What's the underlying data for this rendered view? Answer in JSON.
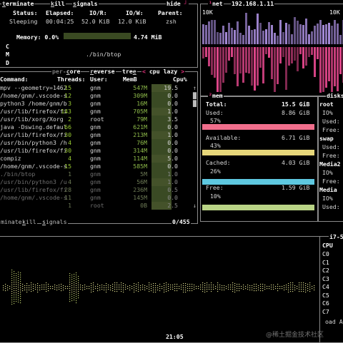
{
  "proc_detail": {
    "actions": {
      "terminate": "terminate",
      "kill": "kill",
      "signals": "signals",
      "hide": "hide"
    },
    "labels": {
      "status": "Status:",
      "elapsed": "Elapsed:",
      "io_r": "IO/R:",
      "io_w": "IO/W:",
      "parent": "Parent:"
    },
    "values": {
      "status": "Sleeping",
      "elapsed": "00:04:25",
      "io_r": "52.0 KiB",
      "io_w": "12.0 KiB",
      "parent": "zsh"
    },
    "memory_label": "Memory: 0.0%",
    "memory_value": "4.74 MiB",
    "memory_fraction": 0.0,
    "cmd_letters": [
      "C",
      "M",
      "D"
    ],
    "cmd_path": "./bin/btop"
  },
  "proc_table": {
    "tabs": {
      "per_core": "per-core",
      "reverse": "reverse",
      "tree": "tree",
      "cpu_lazy": "< cpu lazy >"
    },
    "headers": {
      "command": "Command:",
      "threads": "Threads:",
      "user": "User:",
      "mem": "MemB",
      "cpu": "Cpu%"
    },
    "rows": [
      {
        "command": "mpv --geometry=1462",
        "threads": "15",
        "user": "gnm",
        "mem": "547M",
        "cpu": "19.5"
      },
      {
        "command": "/home/gnm/.vscode-s",
        "threads": "12",
        "user": "gnm",
        "mem": "309M",
        "cpu": "0.0"
      },
      {
        "command": "python3 /home/gnm/b",
        "threads": "3",
        "user": "gnm",
        "mem": "16M",
        "cpu": "0.0"
      },
      {
        "command": "/usr/lib/firefox/fi",
        "threads": "143",
        "user": "gnm",
        "mem": "705M",
        "cpu": "1.0"
      },
      {
        "command": "/usr/lib/xorg/Xorg",
        "threads": "2",
        "user": "root",
        "mem": "79M",
        "cpu": "3.5"
      },
      {
        "command": "java -Dswing.defaul",
        "threads": "66",
        "user": "gnm",
        "mem": "621M",
        "cpu": "0.0"
      },
      {
        "command": "/usr/lib/firefox/fi",
        "threads": "30",
        "user": "gnm",
        "mem": "213M",
        "cpu": "1.0"
      },
      {
        "command": "/usr/bin/python3 /h",
        "threads": "4",
        "user": "gnm",
        "mem": "76M",
        "cpu": "0.0"
      },
      {
        "command": "/usr/lib/firefox/fi",
        "threads": "30",
        "user": "gnm",
        "mem": "314M",
        "cpu": "0.0"
      },
      {
        "command": "compiz",
        "threads": "4",
        "user": "gnm",
        "mem": "114M",
        "cpu": "5.0"
      },
      {
        "command": "/home/gnm/.vscode-s",
        "threads": "15",
        "user": "gnm",
        "mem": "585M",
        "cpu": "0.0"
      },
      {
        "command": "./bin/btop",
        "threads": "1",
        "user": "gnm",
        "mem": "5M",
        "cpu": "1.0"
      },
      {
        "command": "/usr/bin/python3 /u",
        "threads": "4",
        "user": "gnm",
        "mem": "56M",
        "cpu": "1.0"
      },
      {
        "command": "/usr/lib/firefox/fi",
        "threads": "28",
        "user": "gnm",
        "mem": "236M",
        "cpu": "0.5"
      },
      {
        "command": "/home/gnm/.vscode-s",
        "threads": "11",
        "user": "gnm",
        "mem": "145M",
        "cpu": "0.0"
      },
      {
        "command": "",
        "threads": "1",
        "user": "root",
        "mem": "0B",
        "cpu": "2.5"
      }
    ],
    "footer": {
      "terminate": "terminate",
      "kill": "kill",
      "signals": "signals",
      "count": "0/455"
    }
  },
  "net": {
    "title": "net",
    "address": "192.168.1.11",
    "scale_left": "10K",
    "scale_right": "10K",
    "download_color": "#a58ad8",
    "upload_color": "#e0468a"
  },
  "mem": {
    "title": "mem",
    "total_label": "Total:",
    "total_value": "15.5 GiB",
    "used_label": "Used:",
    "used_value": "8.86 GiB",
    "used_pct": "57%",
    "used_fraction": 0.57,
    "used_color": "#f06e8c",
    "avail_label": "Available:",
    "avail_value": "6.71 GiB",
    "avail_pct": "43%",
    "avail_fraction": 0.43,
    "avail_color": "#e6d67a",
    "cached_label": "Cached:",
    "cached_value": "4.03 GiB",
    "cached_pct": "26%",
    "cached_fraction": 0.26,
    "cached_color": "#5ec8e0",
    "free_label": "Free:",
    "free_value": "1.59 GiB",
    "free_pct": "10%",
    "free_fraction": 0.1,
    "free_color": "#b9d486"
  },
  "disks": {
    "title": "disks",
    "entries": [
      {
        "name": "root",
        "lines": [
          "IO%",
          "Used:",
          "Free:"
        ]
      },
      {
        "name": "swap",
        "lines": [
          "Used:",
          "Free:"
        ]
      },
      {
        "name": "Media2",
        "lines": [
          "IO%",
          "Free:"
        ]
      },
      {
        "name": "Media",
        "lines": [
          "IO%",
          "Used:"
        ]
      }
    ]
  },
  "cpu": {
    "clock": "21:05",
    "model": "i7-5",
    "label": "CPU",
    "cores": [
      "C0",
      "C1",
      "C2",
      "C3",
      "C4",
      "C5",
      "C6",
      "C7"
    ],
    "load_fragment": "oad A"
  },
  "watermark": "@稀土掘金技术社区"
}
